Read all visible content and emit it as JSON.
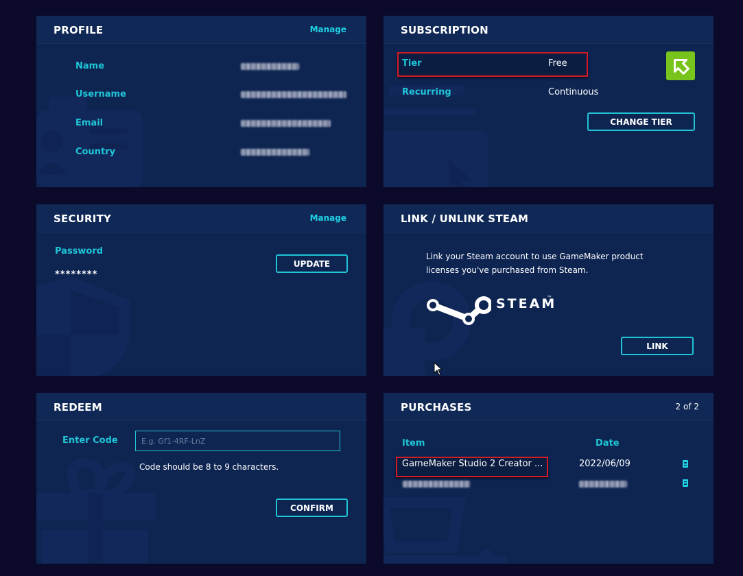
{
  "profile": {
    "title": "PROFILE",
    "manage": "Manage",
    "fields": [
      {
        "label": "Name"
      },
      {
        "label": "Username"
      },
      {
        "label": "Email"
      },
      {
        "label": "Country"
      }
    ]
  },
  "subscription": {
    "title": "SUBSCRIPTION",
    "tier_label": "Tier",
    "tier_value": "Free",
    "recurring_label": "Recurring",
    "recurring_value": "Continuous",
    "change_tier": "CHANGE TIER",
    "badge_icon": "up-arrow-icon",
    "badge_color": "#78c31c"
  },
  "security": {
    "title": "SECURITY",
    "manage": "Manage",
    "password_label": "Password",
    "password_value": "********",
    "update": "UPDATE"
  },
  "steam": {
    "title": "LINK / UNLINK STEAM",
    "description": "Link your Steam account to use GameMaker product licenses you've purchased from Steam.",
    "logo_text": "STEAM",
    "trademark": "™",
    "link": "LINK"
  },
  "redeem": {
    "title": "REDEEM",
    "enter_code_label": "Enter Code",
    "placeholder": "E.g. Gf1-4RF-LnZ",
    "hint": "Code should be 8 to 9 characters.",
    "confirm": "CONFIRM"
  },
  "purchases": {
    "title": "PURCHASES",
    "count": "2 of 2",
    "col_item": "Item",
    "col_date": "Date",
    "rows": [
      {
        "item": "GameMaker Studio 2 Creator ...",
        "date": "2022/06/09"
      }
    ]
  },
  "colors": {
    "page_bg": "#0c0a2a",
    "card_bg": "#0e2552",
    "accent": "#1fc4d6",
    "highlight": "#d31b24"
  }
}
